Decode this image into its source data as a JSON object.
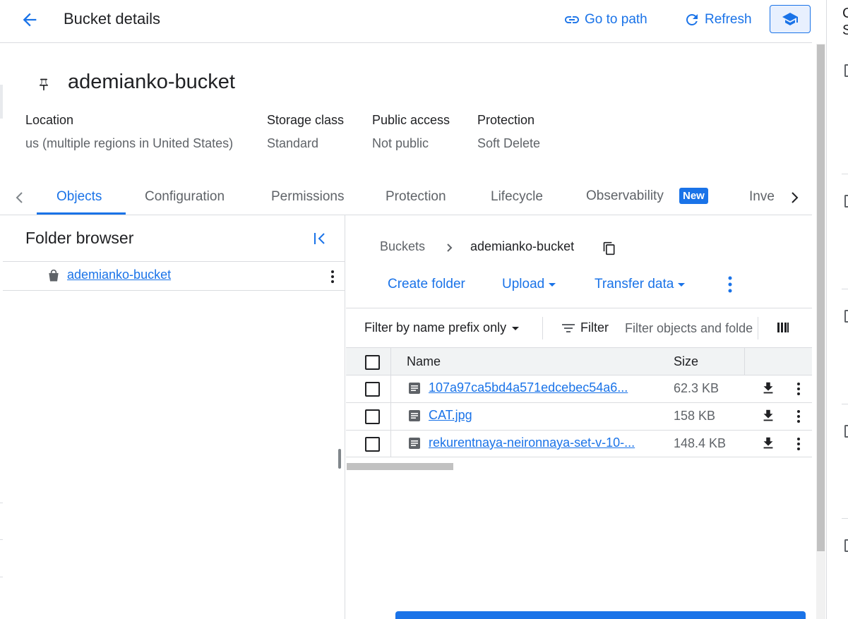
{
  "header": {
    "title": "Bucket details",
    "go_to_path": "Go to path",
    "refresh": "Refresh"
  },
  "bucket": {
    "name": "ademianko-bucket",
    "info": [
      {
        "label": "Location",
        "value": "us (multiple regions in United States)"
      },
      {
        "label": "Storage class",
        "value": "Standard"
      },
      {
        "label": "Public access",
        "value": "Not public"
      },
      {
        "label": "Protection",
        "value": "Soft Delete"
      }
    ]
  },
  "tabs": {
    "items": [
      "Objects",
      "Configuration",
      "Permissions",
      "Protection",
      "Lifecycle",
      "Observability",
      "Inve"
    ],
    "active": "Objects",
    "badge": "New"
  },
  "folder_browser": {
    "title": "Folder browser",
    "bucket": "ademianko-bucket"
  },
  "breadcrumb": {
    "root": "Buckets",
    "current": "ademianko-bucket"
  },
  "actions": {
    "create_folder": "Create folder",
    "upload": "Upload",
    "transfer": "Transfer data"
  },
  "filter": {
    "prefix_mode": "Filter by name prefix only",
    "filter_label": "Filter",
    "placeholder": "Filter objects and folde"
  },
  "table": {
    "columns": [
      "Name",
      "Size"
    ],
    "rows": [
      {
        "name": "107a97ca5bd4a571edcebec54a6...",
        "size": "62.3 KB"
      },
      {
        "name": "CAT.jpg",
        "size": "158 KB"
      },
      {
        "name": "rekurentnaya-neironnaya-set-v-10-...",
        "size": "148.4 KB"
      }
    ]
  },
  "side_panel": {
    "letters": [
      "C",
      "S"
    ]
  },
  "colors": {
    "accent": "#1a73e8",
    "text": "#202124",
    "muted": "#5f6368",
    "divider": "#dadce0"
  }
}
